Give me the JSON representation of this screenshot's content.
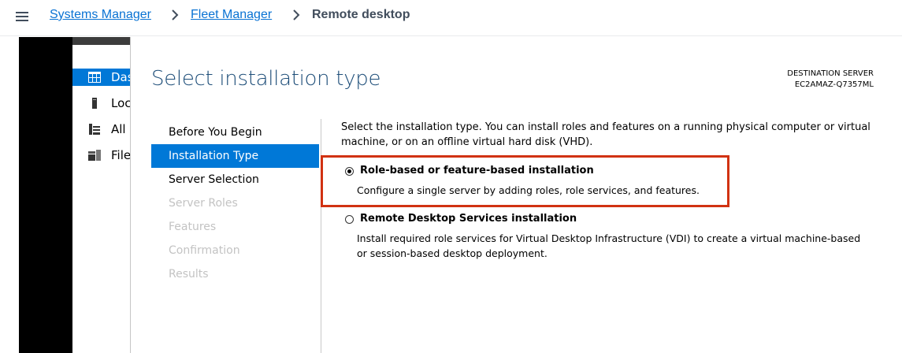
{
  "breadcrumb": {
    "items": [
      "Systems Manager",
      "Fleet Manager"
    ],
    "current": "Remote desktop"
  },
  "server_manager": {
    "items": [
      {
        "label": "Das",
        "icon": "dashboard-icon",
        "active": true
      },
      {
        "label": "Loc",
        "icon": "local-server-icon",
        "active": false
      },
      {
        "label": "All",
        "icon": "all-servers-icon",
        "active": false
      },
      {
        "label": "File",
        "icon": "file-storage-icon",
        "active": false
      }
    ]
  },
  "wizard": {
    "title": "Select installation type",
    "destination_label": "DESTINATION SERVER",
    "destination_server": "EC2AMAZ-Q7357ML",
    "nav": [
      {
        "label": "Before You Begin",
        "state": "enabled"
      },
      {
        "label": "Installation Type",
        "state": "active"
      },
      {
        "label": "Server Selection",
        "state": "enabled"
      },
      {
        "label": "Server Roles",
        "state": "disabled"
      },
      {
        "label": "Features",
        "state": "disabled"
      },
      {
        "label": "Confirmation",
        "state": "disabled"
      },
      {
        "label": "Results",
        "state": "disabled"
      }
    ],
    "intro": "Select the installation type. You can install roles and features on a running physical computer or virtual machine, or on an offline virtual hard disk (VHD).",
    "options": [
      {
        "label": "Role-based or feature-based installation",
        "description": "Configure a single server by adding roles, role services, and features.",
        "selected": true
      },
      {
        "label": "Remote Desktop Services installation",
        "description_line1": "Install required role services for Virtual Desktop Infrastructure (VDI) to create a virtual machine-based",
        "description_line2": "or session-based desktop deployment.",
        "selected": false
      }
    ]
  },
  "colors": {
    "link": "#0972d3",
    "active_blue": "#0078d7",
    "title_blue": "#1e4e79",
    "highlight_red": "#d13212"
  }
}
